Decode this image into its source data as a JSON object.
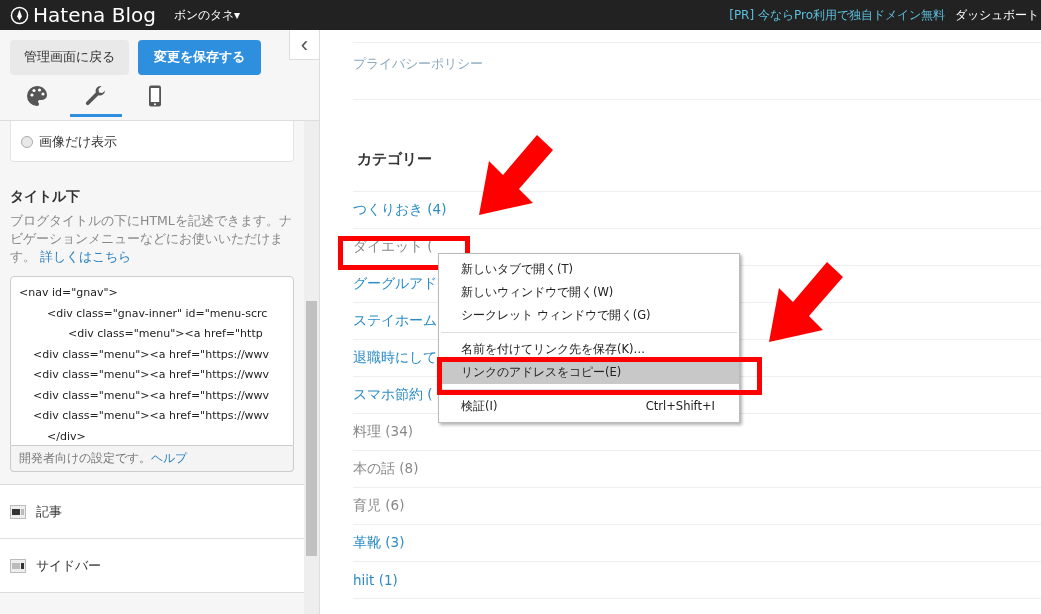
{
  "topbar": {
    "logo": "Hatena Blog",
    "blog_name": "ボンのタネ",
    "blog_caret": "▾",
    "promo": "[PR] 今ならPro利用で独自ドメイン無料",
    "dashboard": "ダッシュボート"
  },
  "sidebar": {
    "back_button": "管理画面に戻る",
    "save_button": "変更を保存する",
    "collapse": "‹",
    "tabs": [
      {
        "selected": false
      },
      {
        "selected": true
      },
      {
        "selected": false
      }
    ],
    "radio_option": {
      "label": "画像だけ表示",
      "checked": false
    },
    "section_title": "タイトル下",
    "description": "ブログタイトルの下にHTMLを記述できます。ナビゲーションメニューなどにお使いいただけます。",
    "description_link": "詳しくはこちら",
    "code_lines": [
      "<nav id=\"gnav\">",
      "        <div class=\"gnav-inner\" id=\"menu-scrc",
      "              <div class=\"menu\"><a href=\"http",
      "    <div class=\"menu\"><a href=\"https://wwv",
      "    <div class=\"menu\"><a href=\"https://wwv",
      "    <div class=\"menu\"><a href=\"https://wwv",
      "    <div class=\"menu\"><a href=\"https://wwv",
      "        </div>"
    ],
    "dev_note": "開発者向けの設定です。",
    "dev_link": "ヘルプ",
    "sections": [
      {
        "label": "記事"
      },
      {
        "label": "サイドバー"
      }
    ]
  },
  "content": {
    "privacy_link": "プライバシーポリシー",
    "categories_title": "カテゴリー",
    "categories": [
      {
        "label": "つくりおき (4)",
        "visited": false
      },
      {
        "label": "ダイエット (",
        "visited": true
      },
      {
        "label": "グーグルアド",
        "visited": false
      },
      {
        "label": "ステイホーム",
        "visited": false
      },
      {
        "label": "退職時にして",
        "visited": false
      },
      {
        "label": "スマホ節約 (",
        "visited": false
      },
      {
        "label": "料理 (34)",
        "visited": true
      },
      {
        "label": "本の話 (8)",
        "visited": true
      },
      {
        "label": "育児 (6)",
        "visited": true
      },
      {
        "label": "革靴 (3)",
        "visited": false
      },
      {
        "label": "hiit (1)",
        "visited": false
      }
    ]
  },
  "context_menu": [
    {
      "kind": "item",
      "label": "新しいタブで開く(T)",
      "selected": false
    },
    {
      "kind": "item",
      "label": "新しいウィンドウで開く(W)",
      "selected": false
    },
    {
      "kind": "item",
      "label": "シークレット ウィンドウで開く(G)",
      "selected": false
    },
    {
      "kind": "separator"
    },
    {
      "kind": "item",
      "label": "名前を付けてリンク先を保存(K)…",
      "selected": false
    },
    {
      "kind": "item",
      "label": "リンクのアドレスをコピー(E)",
      "selected": true
    },
    {
      "kind": "separator"
    },
    {
      "kind": "item",
      "label": "検証(I)",
      "shortcut": "Ctrl+Shift+I",
      "selected": false
    }
  ]
}
